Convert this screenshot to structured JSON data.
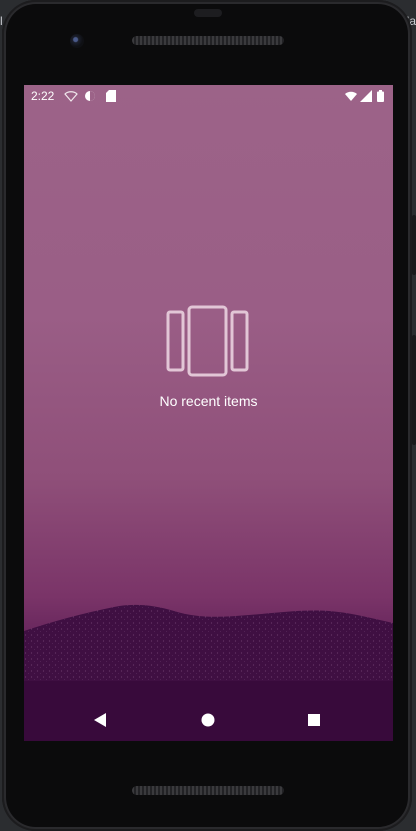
{
  "status_bar": {
    "time": "2:22",
    "left_icons": [
      "wifi-signal-icon",
      "data-saver-icon",
      "sd-card-icon"
    ],
    "right_icons": [
      "wifi-icon",
      "cell-signal-icon",
      "battery-icon"
    ]
  },
  "recents": {
    "empty_icon": "recent-apps-icon",
    "empty_message": "No recent items"
  },
  "nav_bar": {
    "buttons": [
      "back-icon",
      "home-icon",
      "recents-square-icon"
    ]
  },
  "colors": {
    "wallpaper_top": "#9c6388",
    "wallpaper_bottom": "#3b0d3f",
    "text": "#ffffff"
  }
}
